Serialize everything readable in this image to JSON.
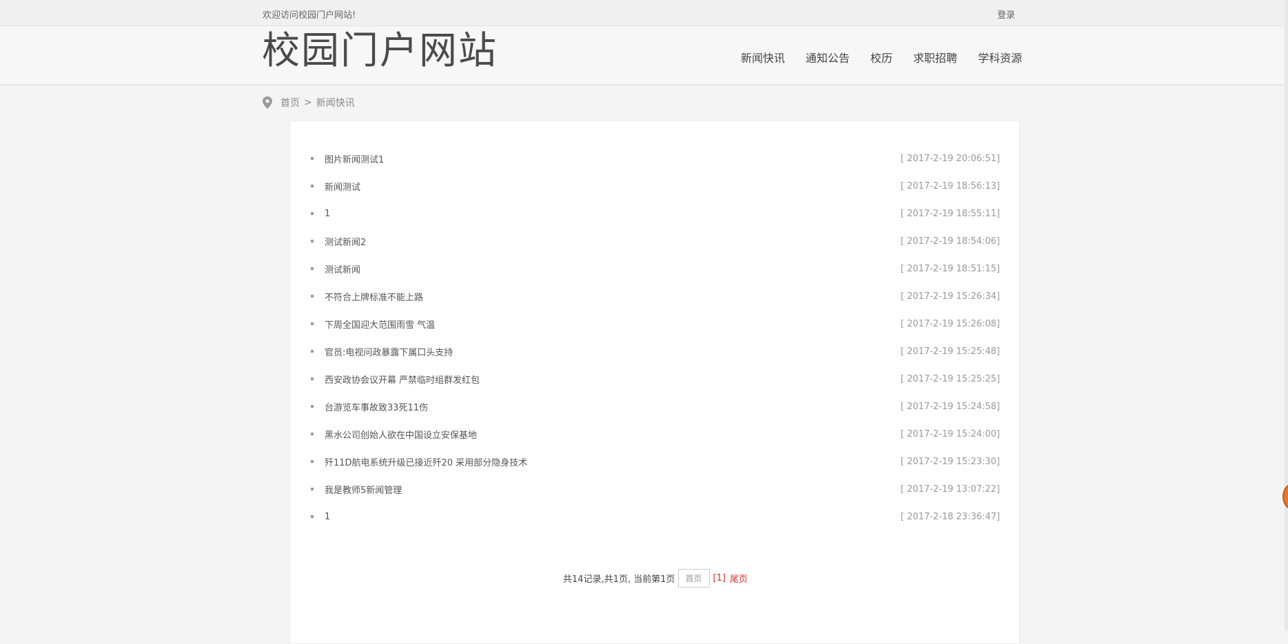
{
  "topbar": {
    "welcome": "欢迎访问校园门户网站!",
    "login": "登录"
  },
  "header": {
    "logo": "校园门户网站",
    "nav": [
      "新闻快讯",
      "通知公告",
      "校历",
      "求职招聘",
      "学科资源"
    ]
  },
  "breadcrumb": {
    "home": "首页",
    "separator": ">",
    "current": "新闻快讯"
  },
  "news": [
    {
      "title": "图片新闻测试1",
      "date": "[ 2017-2-19 20:06:51]"
    },
    {
      "title": "新闻测试",
      "date": "[ 2017-2-19 18:56:13]"
    },
    {
      "title": "1",
      "date": "[ 2017-2-19 18:55:11]"
    },
    {
      "title": "测试新闻2",
      "date": "[ 2017-2-19 18:54:06]"
    },
    {
      "title": "测试新闻",
      "date": "[ 2017-2-19 18:51:15]"
    },
    {
      "title": "不符合上牌标准不能上路",
      "date": "[ 2017-2-19 15:26:34]"
    },
    {
      "title": "下周全国迎大范围雨雪 气温",
      "date": "[ 2017-2-19 15:26:08]"
    },
    {
      "title": "官员:电视问政暴露下属口头支持",
      "date": "[ 2017-2-19 15:25:48]"
    },
    {
      "title": "西安政协会议开幕 严禁临时组群发红包",
      "date": "[ 2017-2-19 15:25:25]"
    },
    {
      "title": "台游览车事故致33死11伤",
      "date": "[ 2017-2-19 15:24:58]"
    },
    {
      "title": "黑水公司创始人欲在中国设立安保基地",
      "date": "[ 2017-2-19 15:24:00]"
    },
    {
      "title": "歼11D航电系统升级已接近歼20 采用部分隐身技术",
      "date": "[ 2017-2-19 15:23:30]"
    },
    {
      "title": "我是教师5新闻管理",
      "date": "[ 2017-2-19 13:07:22]"
    },
    {
      "title": "1",
      "date": "[ 2017-2-18 23:36:47]"
    }
  ],
  "pager": {
    "summary": "共14记录,共1页, 当前第1页",
    "first": "首页",
    "current": "[1]",
    "last": "尾页"
  },
  "colors": {
    "accent": "#dd3333",
    "background": "#f4f4f4"
  },
  "icons": {
    "breadcrumb": "map-pin-icon"
  }
}
